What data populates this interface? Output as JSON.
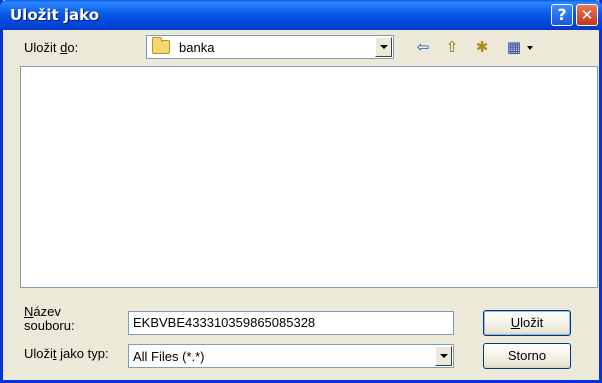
{
  "window": {
    "title": "Uložit jako",
    "help_glyph": "?",
    "close_glyph": "✕"
  },
  "save_in": {
    "label_pre": "Uložit ",
    "label_key": "d",
    "label_post": "o:",
    "value": "banka"
  },
  "toolbar": {
    "back_icon": "⇦",
    "up_icon": "⇧",
    "new_folder_icon": "✱",
    "view_icon": "▦"
  },
  "filename": {
    "label_key": "N",
    "label_rest": "ázev",
    "label_line2": "souboru:",
    "value": "EKBVBE433310359865085328"
  },
  "filetype": {
    "label_pre": "Uloži",
    "label_key": "t",
    "label_post": " jako typ:",
    "value": "All Files (*.*)"
  },
  "buttons": {
    "save_key": "U",
    "save_rest": "ložit",
    "cancel": "Storno"
  }
}
